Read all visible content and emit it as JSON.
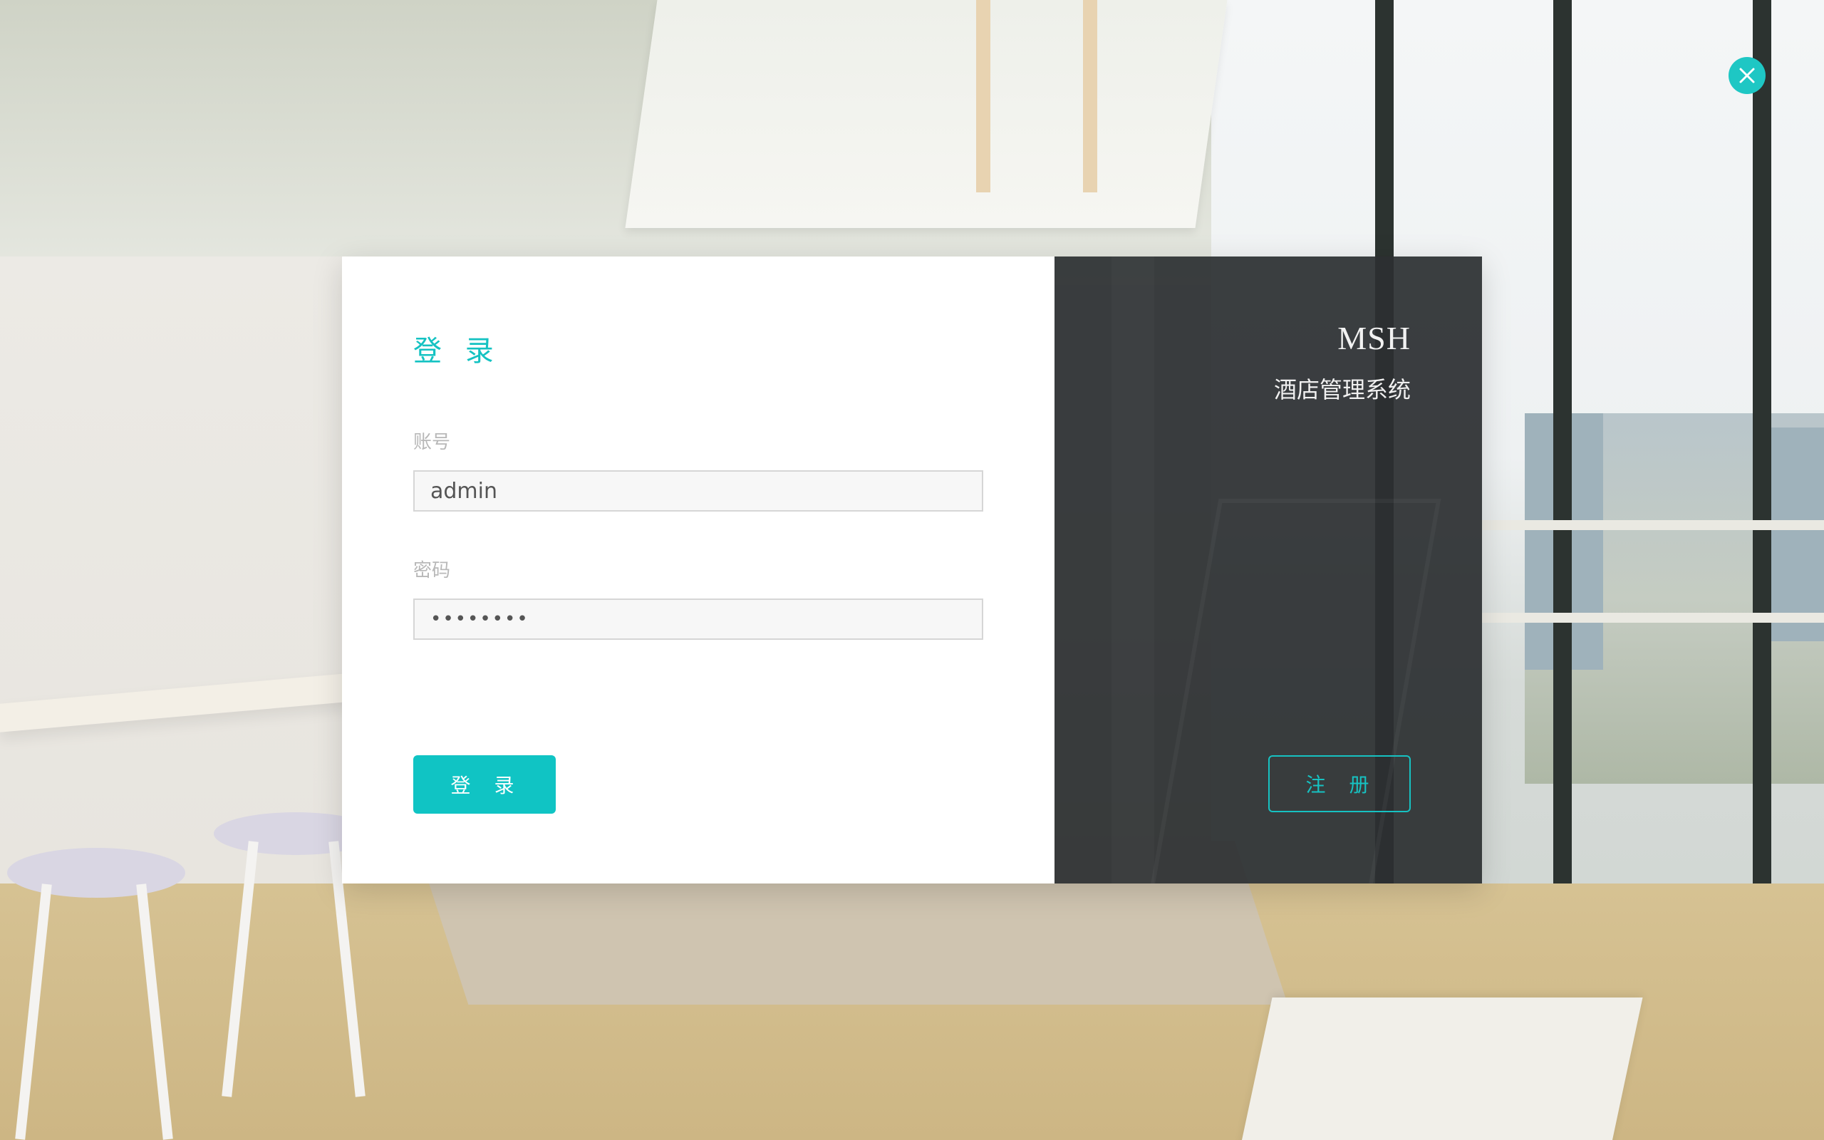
{
  "close_icon": "close-icon",
  "accent_color": "#10c4c4",
  "login_panel": {
    "title": "登 录",
    "username": {
      "label": "账号",
      "value": "admin"
    },
    "password": {
      "label": "密码",
      "value": "••••••••"
    },
    "submit_label": "登 录"
  },
  "brand_panel": {
    "name": "MSH",
    "subtitle": "酒店管理系统",
    "register_label": "注 册"
  }
}
